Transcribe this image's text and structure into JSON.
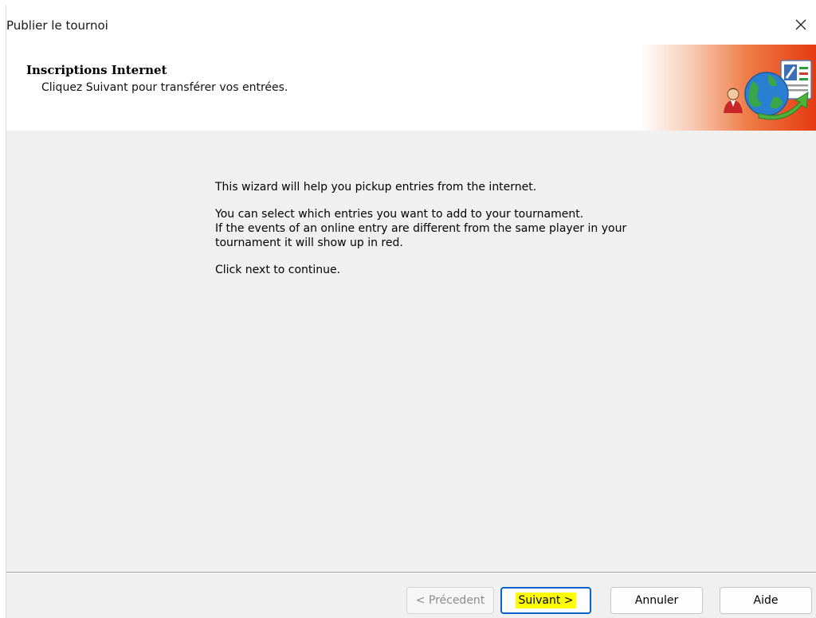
{
  "window": {
    "title": "Publier le tournoi",
    "close_glyph": "✕"
  },
  "header": {
    "title": "Inscriptions Internet",
    "subtitle": "Cliquez Suivant pour transférer vos entrées.",
    "icon": "globe-transfer-icon"
  },
  "body": {
    "line1": "This wizard will help you pickup entries from the internet.",
    "line2": "You can select which entries you want to add to your tournament.",
    "line3": "If the events of an online entry are different from the same player in your",
    "line4": "tournament it will show up in red.",
    "line5": "Click next to continue."
  },
  "buttons": {
    "previous": "< Précedent",
    "next": "Suivant >",
    "cancel": "Annuler",
    "help": "Aide"
  },
  "colors": {
    "header_accent": "#e53a12",
    "primary_border": "#0a64c8",
    "highlight": "#ffff00"
  }
}
